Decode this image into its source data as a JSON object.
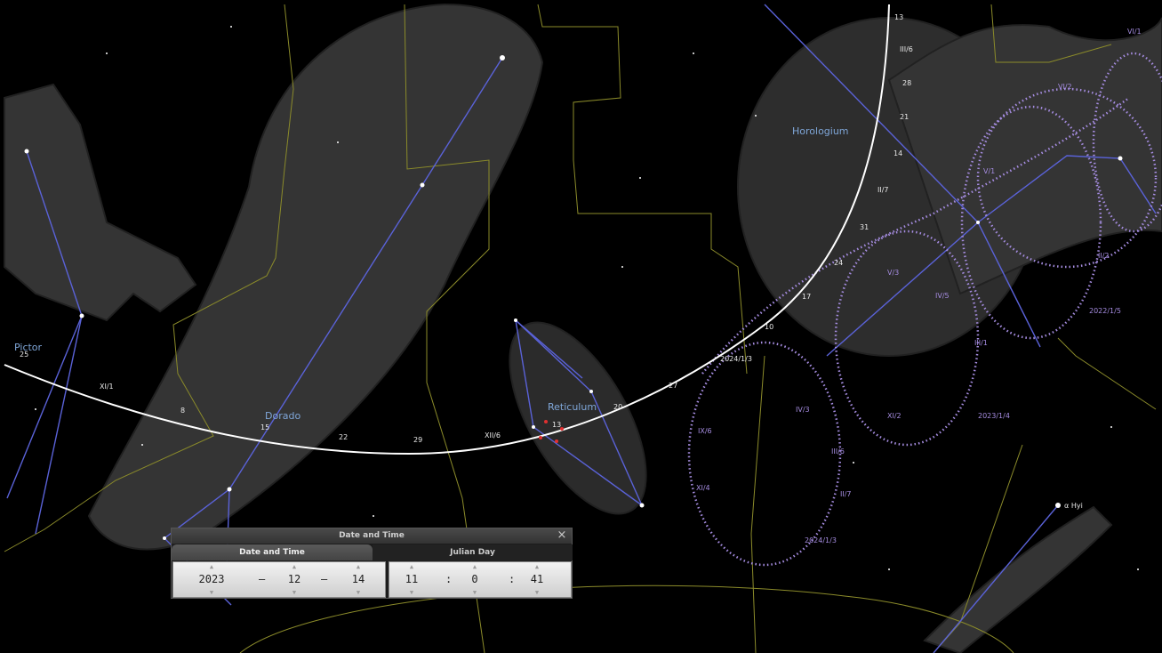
{
  "sky": {
    "constellations": [
      "Pictor",
      "Dorado",
      "Reticulum",
      "Horologium"
    ],
    "star_label": "α Hyi",
    "white_path_labels": [
      "13",
      "III/6",
      "28",
      "21",
      "14",
      "II/7",
      "31",
      "24",
      "17",
      "10",
      "2024/1/3",
      "27",
      "20",
      "13",
      "XII/6",
      "29",
      "22",
      "15",
      "8",
      "XI/1",
      "25"
    ],
    "purple_path_labels": [
      "VI/1",
      "V/1",
      "IV/5",
      "III/1",
      "II/2",
      "XI/4",
      "IX/6",
      "2023/1/4",
      "2022/1/5",
      "II/7",
      "2024/1/3",
      "VI/2",
      "V/3",
      "IV/3",
      "III/6",
      "XI/2"
    ]
  },
  "dialog": {
    "title": "Date and Time",
    "close": "×",
    "tabs": {
      "date_time": "Date and Time",
      "julian_day": "Julian Day"
    },
    "date": {
      "year": "2023",
      "month": "12",
      "day": "14",
      "sep": "–"
    },
    "time": {
      "hour": "11",
      "minute": "0",
      "second": "41",
      "sep": ":"
    },
    "arrow_up": "▲",
    "arrow_down": "▼"
  },
  "colors": {
    "constellation_line": "#5a62d8",
    "boundary": "#8b8b2a",
    "white_path": "#ffffff",
    "purple_path": "#a58ce0",
    "label": "#7fa6d8"
  }
}
